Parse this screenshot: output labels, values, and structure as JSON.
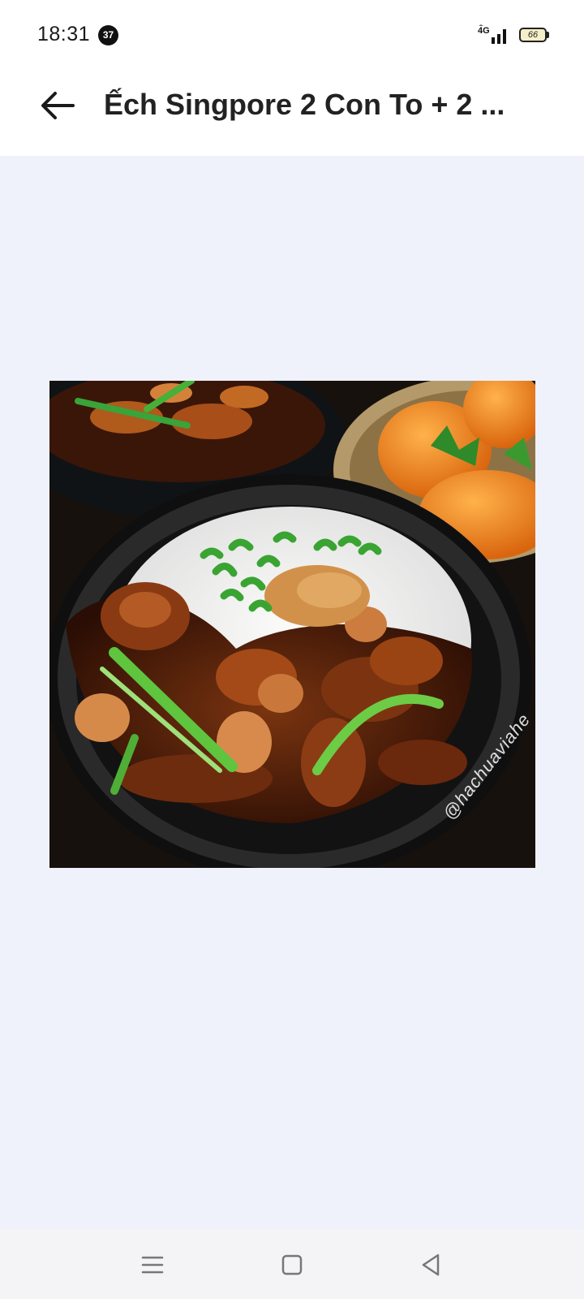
{
  "status_bar": {
    "time": "18:31",
    "notification_count": "37",
    "network": "4G",
    "battery": "66"
  },
  "header": {
    "title": "Ếch Singpore 2 Con To + 2 ...",
    "back_icon": "arrow-left-icon"
  },
  "photo": {
    "watermark": "@hachuaviahe"
  },
  "nav_bar": {
    "menu_icon": "menu-icon",
    "home_icon": "square-home-icon",
    "back_icon": "triangle-back-icon"
  }
}
